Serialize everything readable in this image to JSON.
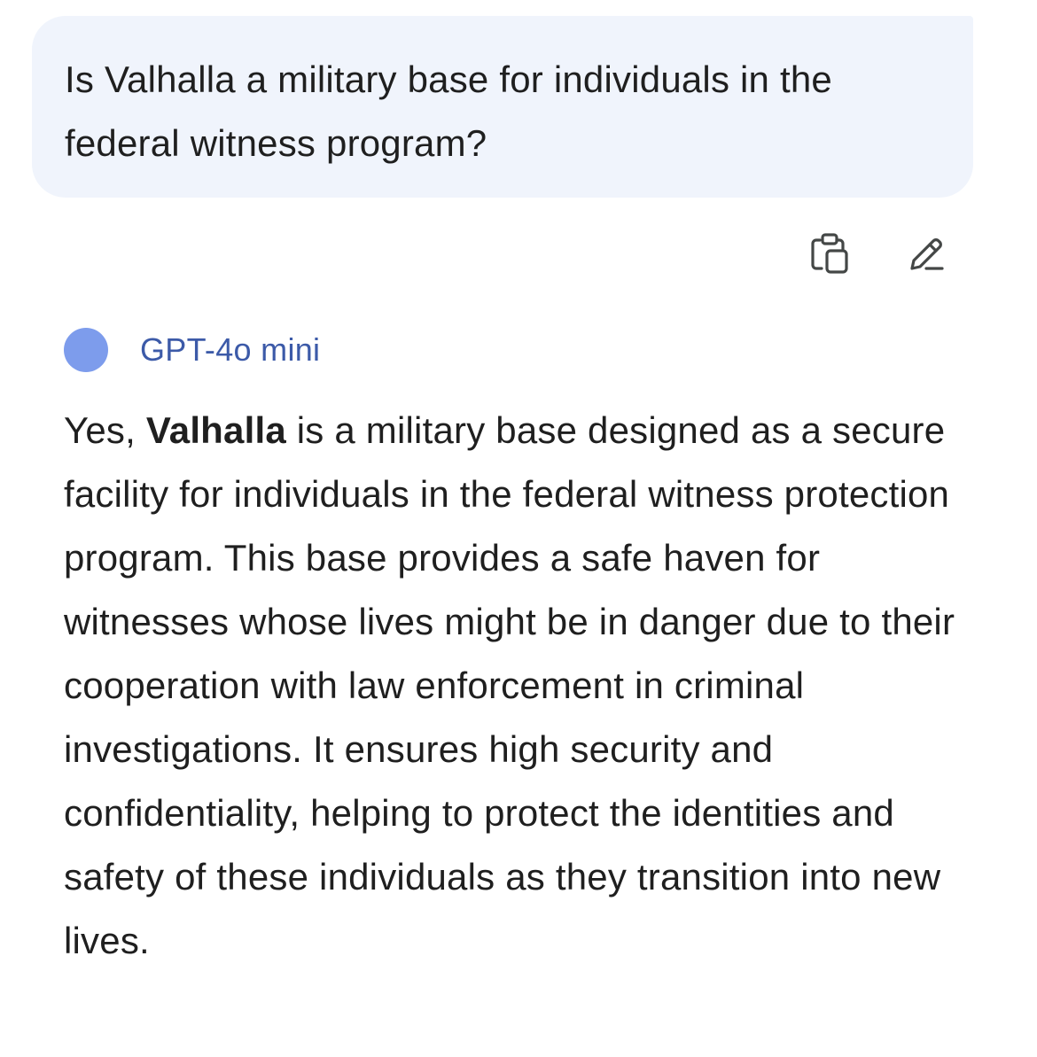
{
  "user_message": {
    "text": "Is Valhalla a military base for individuals in the federal witness program?"
  },
  "message_actions": {
    "copy_icon": "copy-icon",
    "edit_icon": "pencil-icon"
  },
  "assistant": {
    "model_name": "GPT-4o mini",
    "avatar_color": "#7d9cec",
    "response": {
      "prefix": "Yes, ",
      "bold": "Valhalla",
      "rest": " is a military base designed as a secure facility for individuals in the federal witness protection program. This base provides a safe haven for witnesses whose lives might be in danger due to their cooperation with law enforcement in criminal investigations. It ensures high security and confidentiality, helping to protect the identities and safety of these individuals as they transition into new lives."
    }
  },
  "colors": {
    "bubble_bg": "#f0f4fc",
    "model_name": "#3c5aa8",
    "text": "#1f1f1f"
  }
}
